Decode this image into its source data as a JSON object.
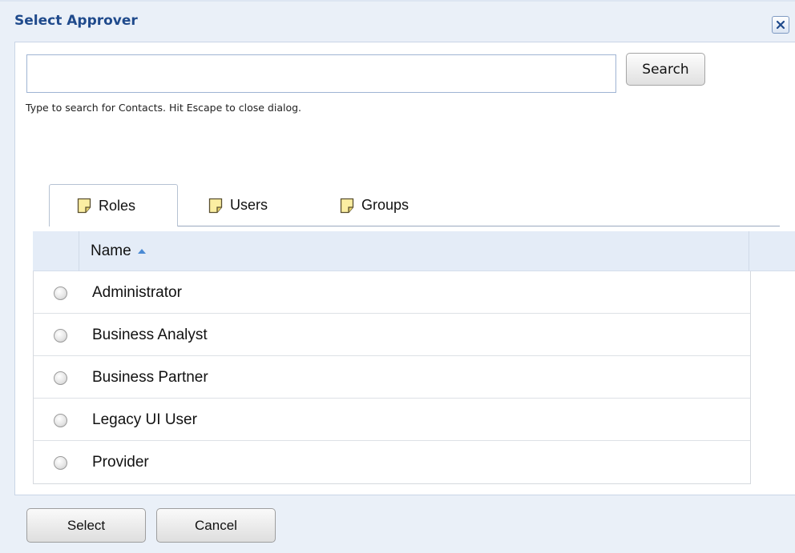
{
  "dialog": {
    "title": "Select Approver",
    "close_icon": "close-x-icon"
  },
  "search": {
    "value": "",
    "placeholder": "",
    "button_label": "Search",
    "hint": "Type to search for Contacts. Hit Escape to close dialog."
  },
  "tabs": [
    {
      "label": "Roles",
      "icon": "note-page-icon",
      "active": true
    },
    {
      "label": "Users",
      "icon": "note-page-icon",
      "active": false
    },
    {
      "label": "Groups",
      "icon": "note-page-icon",
      "active": false
    }
  ],
  "grid": {
    "columns": [
      {
        "label": "Name",
        "sort": "ascending"
      }
    ],
    "rows": [
      {
        "name": "Administrator",
        "selected": false
      },
      {
        "name": "Business Analyst",
        "selected": false
      },
      {
        "name": "Business Partner",
        "selected": false
      },
      {
        "name": "Legacy UI User",
        "selected": false
      },
      {
        "name": "Provider",
        "selected": false
      }
    ]
  },
  "footer": {
    "select_label": "Select",
    "cancel_label": "Cancel"
  },
  "colors": {
    "title_text": "#1f4a8c",
    "dialog_bg": "#eaf0f8",
    "grid_header_bg": "#e4ecf7",
    "sort_arrow": "#4a8ad4"
  }
}
